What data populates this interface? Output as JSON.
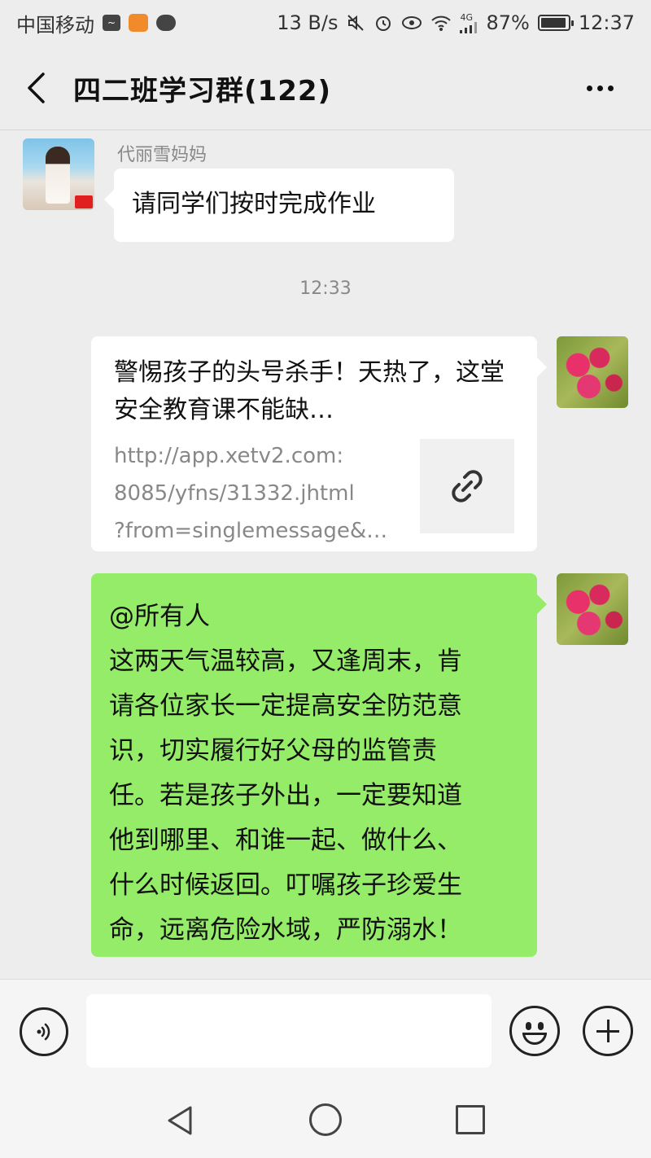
{
  "status_bar": {
    "carrier": "中国移动",
    "net_speed": "13 B/s",
    "network": "4G",
    "battery": "87%",
    "time": "12:37"
  },
  "header": {
    "title": "四二班学习群(122)"
  },
  "messages": [
    {
      "sender": "代丽雪妈妈",
      "text": "请同学们按时完成作业"
    }
  ],
  "timestamp": "12:33",
  "link_card": {
    "title": "警惕孩子的头号杀手！天热了，这堂安全教育课不能缺…",
    "url": "http://app.xetv2.com:\n8085/yfns/31332.jhtml\n?from=singlemessage&…"
  },
  "green_message": {
    "lines": [
      "@所有人",
      "这两天气温较高，又逢周末，肯",
      "请各位家长一定提高安全防范意",
      "识，切实履行好父母的监管责",
      "任。若是孩子外出，一定要知道",
      "他到哪里、和谁一起、做什么、",
      "什么时候返回。叮嘱孩子珍爱生",
      "命，远离危险水域，严防溺水！"
    ]
  },
  "input": {
    "placeholder": ""
  },
  "icons": {
    "back": "chevron-left-icon",
    "more": "more-dots-icon",
    "voice": "voice-icon",
    "emoji": "emoji-icon",
    "plus": "plus-icon",
    "link": "link-icon"
  },
  "colors": {
    "background": "#ededed",
    "bubble_self": "#95ec69",
    "bubble_other": "#ffffff"
  }
}
